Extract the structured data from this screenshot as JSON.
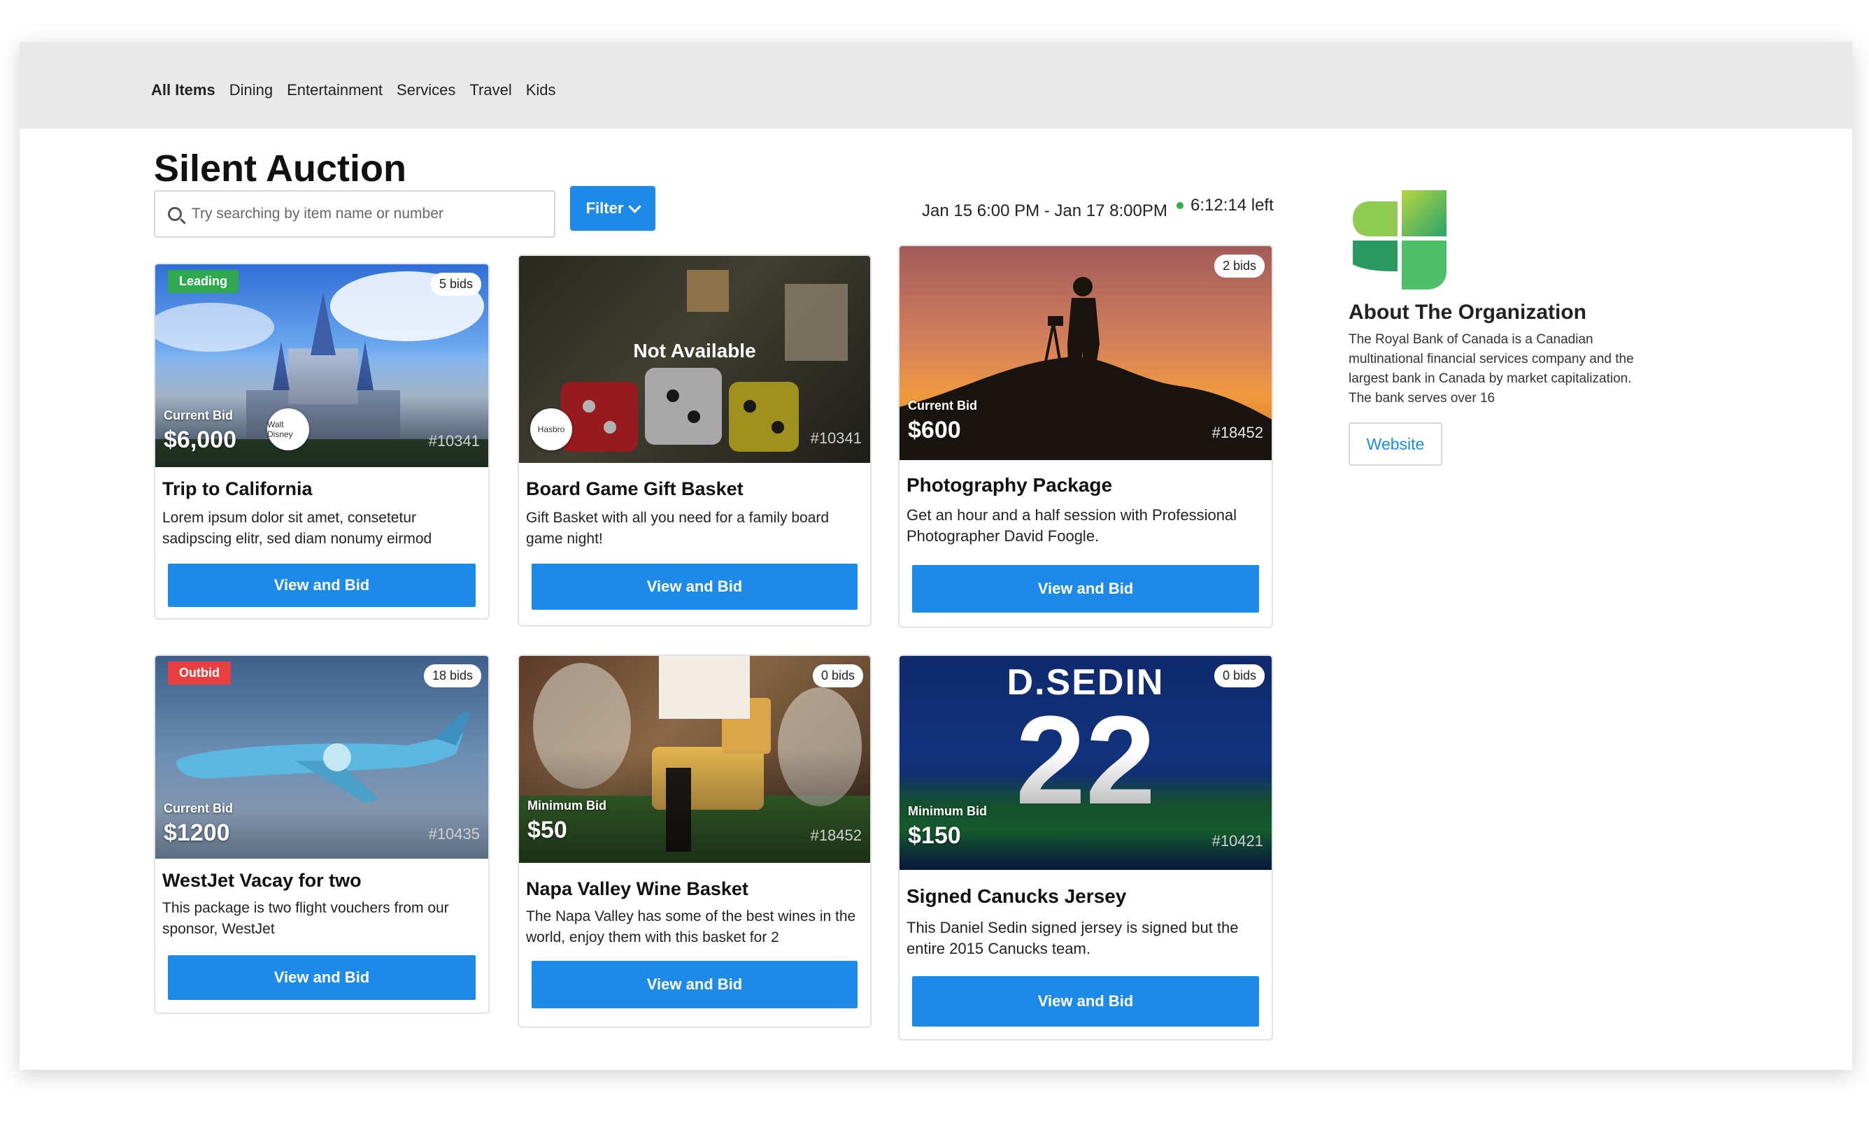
{
  "nav": {
    "items": [
      "All Items",
      "Dining",
      "Entertainment",
      "Services",
      "Travel",
      "Kids"
    ]
  },
  "page": {
    "title": "Silent Auction",
    "search_placeholder": "Try searching by item name or number",
    "filter_label": "Filter",
    "dates": "Jan 15 6:00 PM - Jan 17 8:00PM",
    "time_left": "6:12:14 left"
  },
  "items": [
    {
      "title": "Trip to California",
      "desc": "Lorem ipsum dolor sit amet, consetetur sadipscing elitr, sed diam nonumy eirmod",
      "badge": "Leading",
      "bids": "5 bids",
      "bid_label": "Current Bid",
      "bid_amount": "$6,000",
      "number": "#10341",
      "sponsor": "Walt Disney",
      "button": "View and Bid"
    },
    {
      "title": "Board Game Gift Basket",
      "desc": "Gift Basket with all you need for a family board game night!",
      "status": "Not Available",
      "number": "#10341",
      "sponsor": "Hasbro",
      "button": "View and Bid"
    },
    {
      "title": "Photography Package",
      "desc": "Get an hour and a half session with Professional Photographer David Foogle.",
      "bids": "2 bids",
      "bid_label": "Current Bid",
      "bid_amount": "$600",
      "number": "#18452",
      "button": "View and Bid"
    },
    {
      "title": "WestJet Vacay for two",
      "desc": "This package is two flight vouchers from our sponsor, WestJet",
      "badge": "Outbid",
      "bids": "18 bids",
      "bid_label": "Current Bid",
      "bid_amount": "$1200",
      "number": "#10435",
      "button": "View and Bid"
    },
    {
      "title": "Napa Valley Wine Basket",
      "desc": "The Napa Valley has some of the best wines in the world, enjoy them with this basket for 2",
      "bids": "0 bids",
      "bid_label": "Minimum Bid",
      "bid_amount": "$50",
      "number": "#18452",
      "button": "View and Bid"
    },
    {
      "title": "Signed Canucks Jersey",
      "desc": "This Daniel Sedin signed jersey is signed but the entire 2015 Canucks team.",
      "bids": "0 bids",
      "bid_label": "Minimum Bid",
      "bid_amount": "$150",
      "number": "#10421",
      "jersey_name": "D.SEDIN",
      "jersey_number": "22",
      "button": "View and Bid"
    }
  ],
  "organization": {
    "title": "About The Organization",
    "description": "The Royal Bank of Canada is a Canadian multinational financial services company and the largest bank in Canada by market capitalization. The bank serves over 16",
    "website_label": "Website"
  },
  "colors": {
    "primary": "#1d8ae8",
    "leading": "#2fa84f",
    "outbid": "#e84040",
    "topbar": "#e9e9e9"
  }
}
